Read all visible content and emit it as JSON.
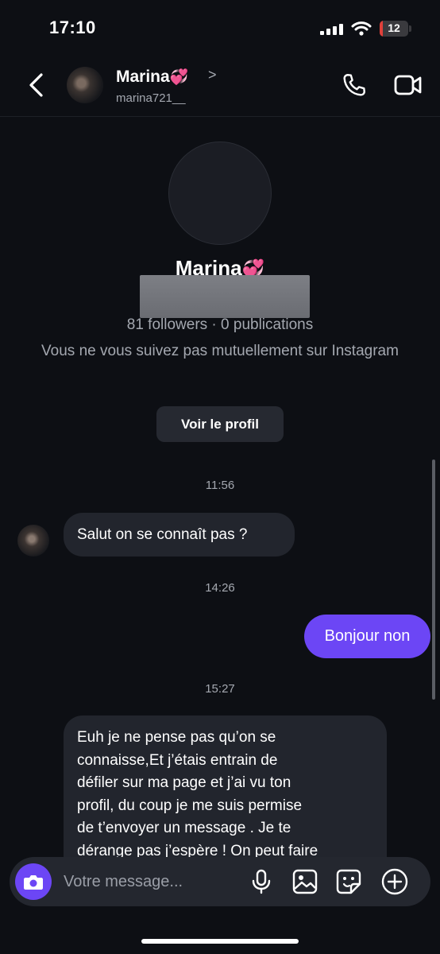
{
  "status_bar": {
    "time": "17:10",
    "battery": "12",
    "battery_level": 0.12
  },
  "header": {
    "name": "Marina",
    "name_emoji": "💞",
    "username": "marina721__",
    "chevron": ">"
  },
  "profile": {
    "name": "Marina",
    "name_emoji": "💞",
    "stats": "81 followers · 0 publications",
    "note": "Vous ne vous suivez pas mutuellement sur Instagram",
    "view_profile_label": "Voir le profil"
  },
  "messages": [
    {
      "timestamp": "11:56"
    },
    {
      "from": "them",
      "text": "Salut on se connaît pas ?"
    },
    {
      "timestamp": "14:26"
    },
    {
      "from": "me",
      "text": "Bonjour non"
    },
    {
      "timestamp": "15:27"
    },
    {
      "from": "them",
      "lines": [
        "Euh je ne pense pas qu’on se",
        "connaisse,Et j’étais entrain de",
        "défiler sur ma page et j’ai vu ton",
        "profil, du coup je me suis permise",
        "de t’envoyer un message . Je te",
        "dérange pas j’espère ! On peut faire"
      ]
    }
  ],
  "composer": {
    "placeholder": "Votre message..."
  },
  "colors": {
    "accent": "#6c46f5",
    "background": "#0d0f14",
    "bubble_in": "#22252d"
  },
  "icons": [
    "back-icon",
    "phone-icon",
    "video-icon",
    "camera-icon",
    "mic-icon",
    "image-icon",
    "sticker-icon",
    "plus-icon"
  ]
}
